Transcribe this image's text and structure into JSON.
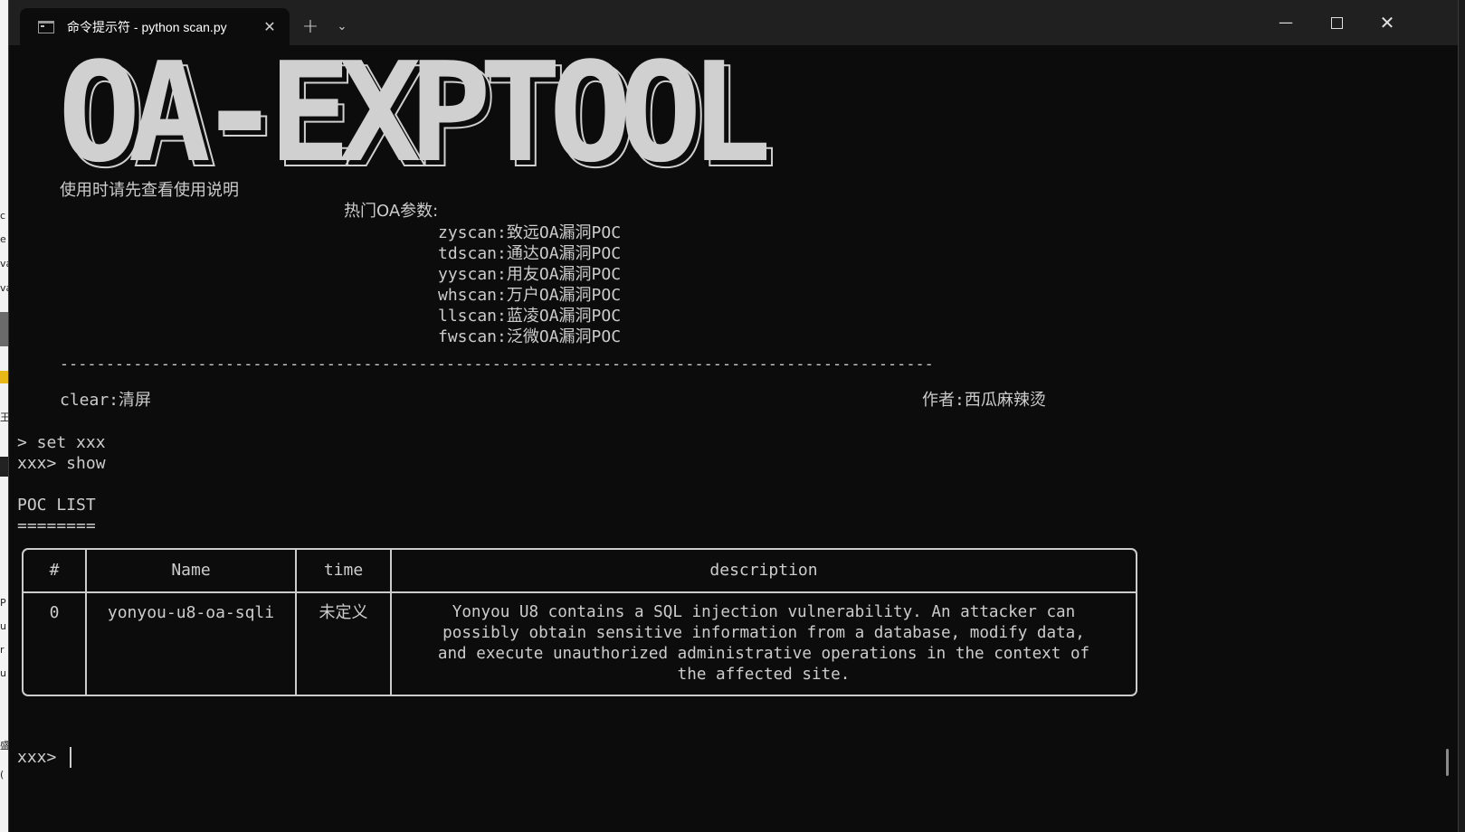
{
  "window": {
    "tab_title": "命令提示符 - python  scan.py",
    "icons": {
      "tab": "terminal-icon",
      "close_tab": "✕",
      "new_tab": "+",
      "dropdown": "⌄",
      "minimize": "—",
      "close": "✕"
    }
  },
  "banner": {
    "logo": "OA-EXPTOOL",
    "notice": "使用时请先查看使用说明",
    "params_title": "热门OA参数:",
    "params": [
      "zyscan:致远OA漏洞POC",
      "tdscan:通达OA漏洞POC",
      "yyscan:用友OA漏洞POC",
      "whscan:万户OA漏洞POC",
      "llscan:蓝凌OA漏洞POC",
      "fwscan:泛微OA漏洞POC"
    ],
    "divider": "-----------------------------------------------------------------------------------------------",
    "clear": "clear:清屏",
    "author": "作者:西瓜麻辣烫"
  },
  "session": {
    "line1": "> set xxx",
    "line2": "xxx> show",
    "list_title": "POC LIST",
    "underline": "========",
    "prompt": "xxx> "
  },
  "table": {
    "headers": [
      "#",
      "Name",
      "time",
      "description"
    ],
    "rows": [
      {
        "num": "0",
        "name": "yonyou-u8-oa-sqli",
        "time": "未定义",
        "description": "Yonyou U8 contains a SQL injection vulnerability. An attacker can\npossibly obtain sensitive information from a database, modify data,\nand execute unauthorized administrative operations in the context of\nthe affected site."
      }
    ]
  },
  "background_window": {
    "edge_glyphs": [
      "c",
      "e",
      "va",
      "va",
      "王",
      "P",
      "u",
      "r",
      "u",
      "盛",
      "("
    ]
  },
  "colors": {
    "terminal_bg": "#0c0c0c",
    "titlebar_bg": "#202020",
    "text": "#cccccc"
  }
}
